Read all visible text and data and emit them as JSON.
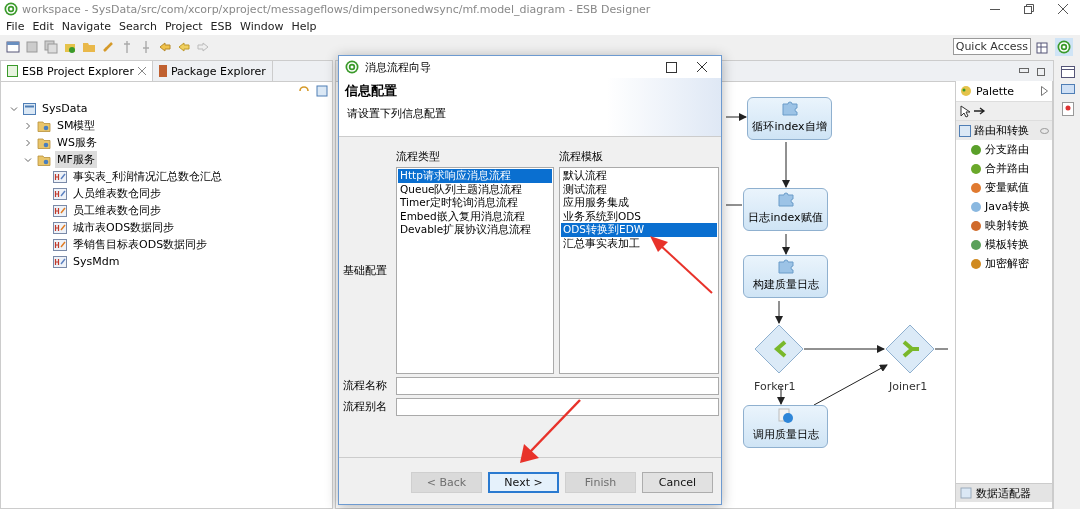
{
  "window": {
    "title": "workspace - SysData/src/com/xcorp/xproject/messageflows/dimpersonedwsync/mf.model_diagram - ESB Designer"
  },
  "menu": [
    "File",
    "Edit",
    "Navigate",
    "Search",
    "Project",
    "ESB",
    "Window",
    "Help"
  ],
  "quick_access": "Quick Access",
  "explorer": {
    "tabs": [
      {
        "label": "ESB Project Explorer",
        "selected": true
      },
      {
        "label": "Package Explorer",
        "selected": false
      }
    ],
    "tree": [
      {
        "label": "SysData",
        "expanded": true,
        "children": [
          {
            "label": "SM模型",
            "expanded": false,
            "selected": false
          },
          {
            "label": "WS服务",
            "expanded": false,
            "selected": false
          },
          {
            "label": "MF服务",
            "expanded": true,
            "selected": true,
            "children": [
              {
                "label": "事实表_利润情况汇总数仓汇总"
              },
              {
                "label": "人员维表数仓同步"
              },
              {
                "label": "员工维表数仓同步"
              },
              {
                "label": "城市表ODS数据同步"
              },
              {
                "label": "季销售目标表ODS数据同步"
              },
              {
                "label": "SysMdm"
              }
            ]
          }
        ]
      }
    ]
  },
  "diagram": {
    "nodes": [
      {
        "kind": "task",
        "label": "循环index自增"
      },
      {
        "kind": "task",
        "label": "日志index赋值"
      },
      {
        "kind": "task",
        "label": "构建质量日志"
      },
      {
        "kind": "fork",
        "label": "Forker1"
      },
      {
        "kind": "join",
        "label": "Joiner1"
      },
      {
        "kind": "invoke",
        "label": "调用质量日志"
      }
    ]
  },
  "palette": {
    "title": "Palette",
    "group": "路由和转换",
    "items": [
      "分支路由",
      "合并路由",
      "变量赋值",
      "Java转换",
      "映射转换",
      "模板转换",
      "加密解密"
    ],
    "drawers": [
      "数据适配器"
    ]
  },
  "dialog": {
    "title": "消息流程向导",
    "heading": "信息配置",
    "description": "请设置下列信息配置",
    "side_label": "基础配置",
    "type_label": "流程类型",
    "types": [
      {
        "label": "Http请求响应消息流程",
        "selected": true
      },
      {
        "label": "Queue队列主题消息流程",
        "selected": false
      },
      {
        "label": "Timer定时轮询消息流程",
        "selected": false
      },
      {
        "label": "Embed嵌入复用消息流程",
        "selected": false
      },
      {
        "label": "Devable扩展协议消息流程",
        "selected": false
      }
    ],
    "template_label": "流程模板",
    "templates": [
      {
        "label": "默认流程",
        "selected": false
      },
      {
        "label": "测试流程",
        "selected": false
      },
      {
        "label": "应用服务集成",
        "selected": false
      },
      {
        "label": "业务系统到ODS",
        "selected": false
      },
      {
        "label": "ODS转换到EDW",
        "selected": true
      },
      {
        "label": "汇总事实表加工",
        "selected": false
      }
    ],
    "fields": [
      {
        "label": "流程名称"
      },
      {
        "label": "流程别名"
      }
    ],
    "buttons": [
      {
        "label": "< Back",
        "disabled": true,
        "default": false
      },
      {
        "label": "Next >",
        "disabled": false,
        "default": true
      },
      {
        "label": "Finish",
        "disabled": true,
        "default": false
      },
      {
        "label": "Cancel",
        "disabled": false,
        "default": false
      }
    ]
  }
}
